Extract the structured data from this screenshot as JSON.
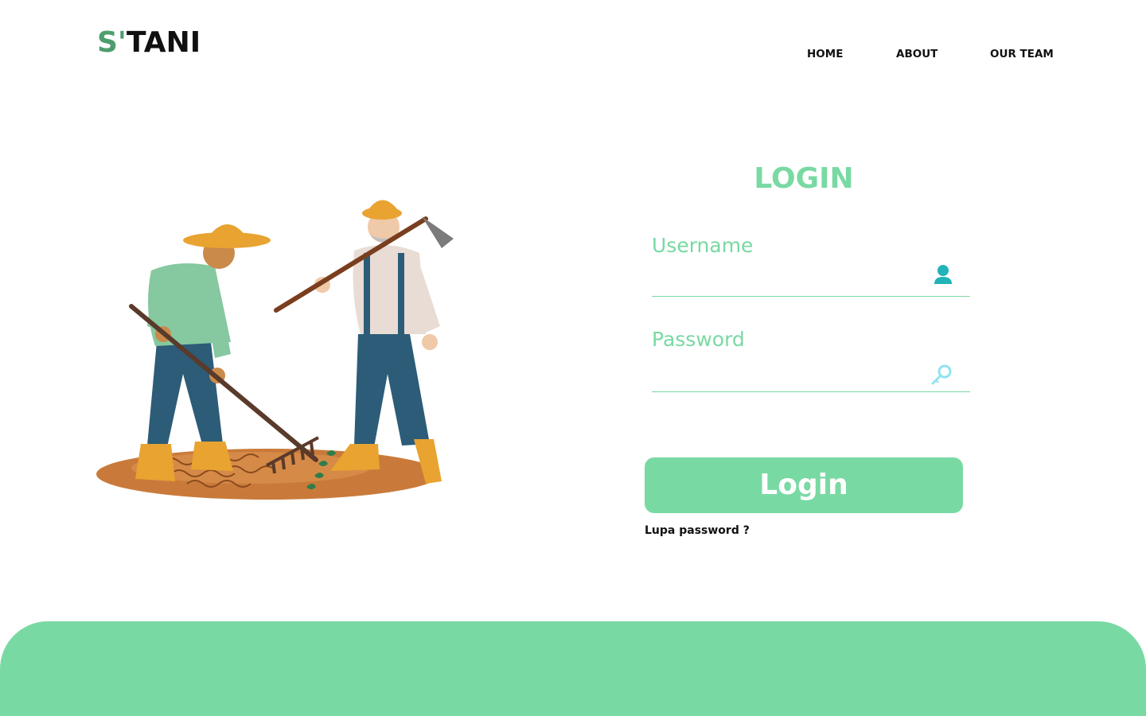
{
  "header": {
    "logo_prefix": "S'",
    "logo_suffix": "TANI",
    "nav": {
      "home": "HOME",
      "about": "ABOUT",
      "our_team": "OUR TEAM"
    }
  },
  "login": {
    "title": "LOGIN",
    "username_label": "Username",
    "username_value": "",
    "password_label": "Password",
    "password_value": "",
    "button_label": "Login",
    "forgot_link": "Lupa password ?"
  },
  "icons": {
    "user": "user-icon",
    "key": "key-icon"
  },
  "colors": {
    "accent": "#79d9a3",
    "logo_accent": "#4f9d6e",
    "text": "#111111",
    "background": "#ffffff"
  }
}
